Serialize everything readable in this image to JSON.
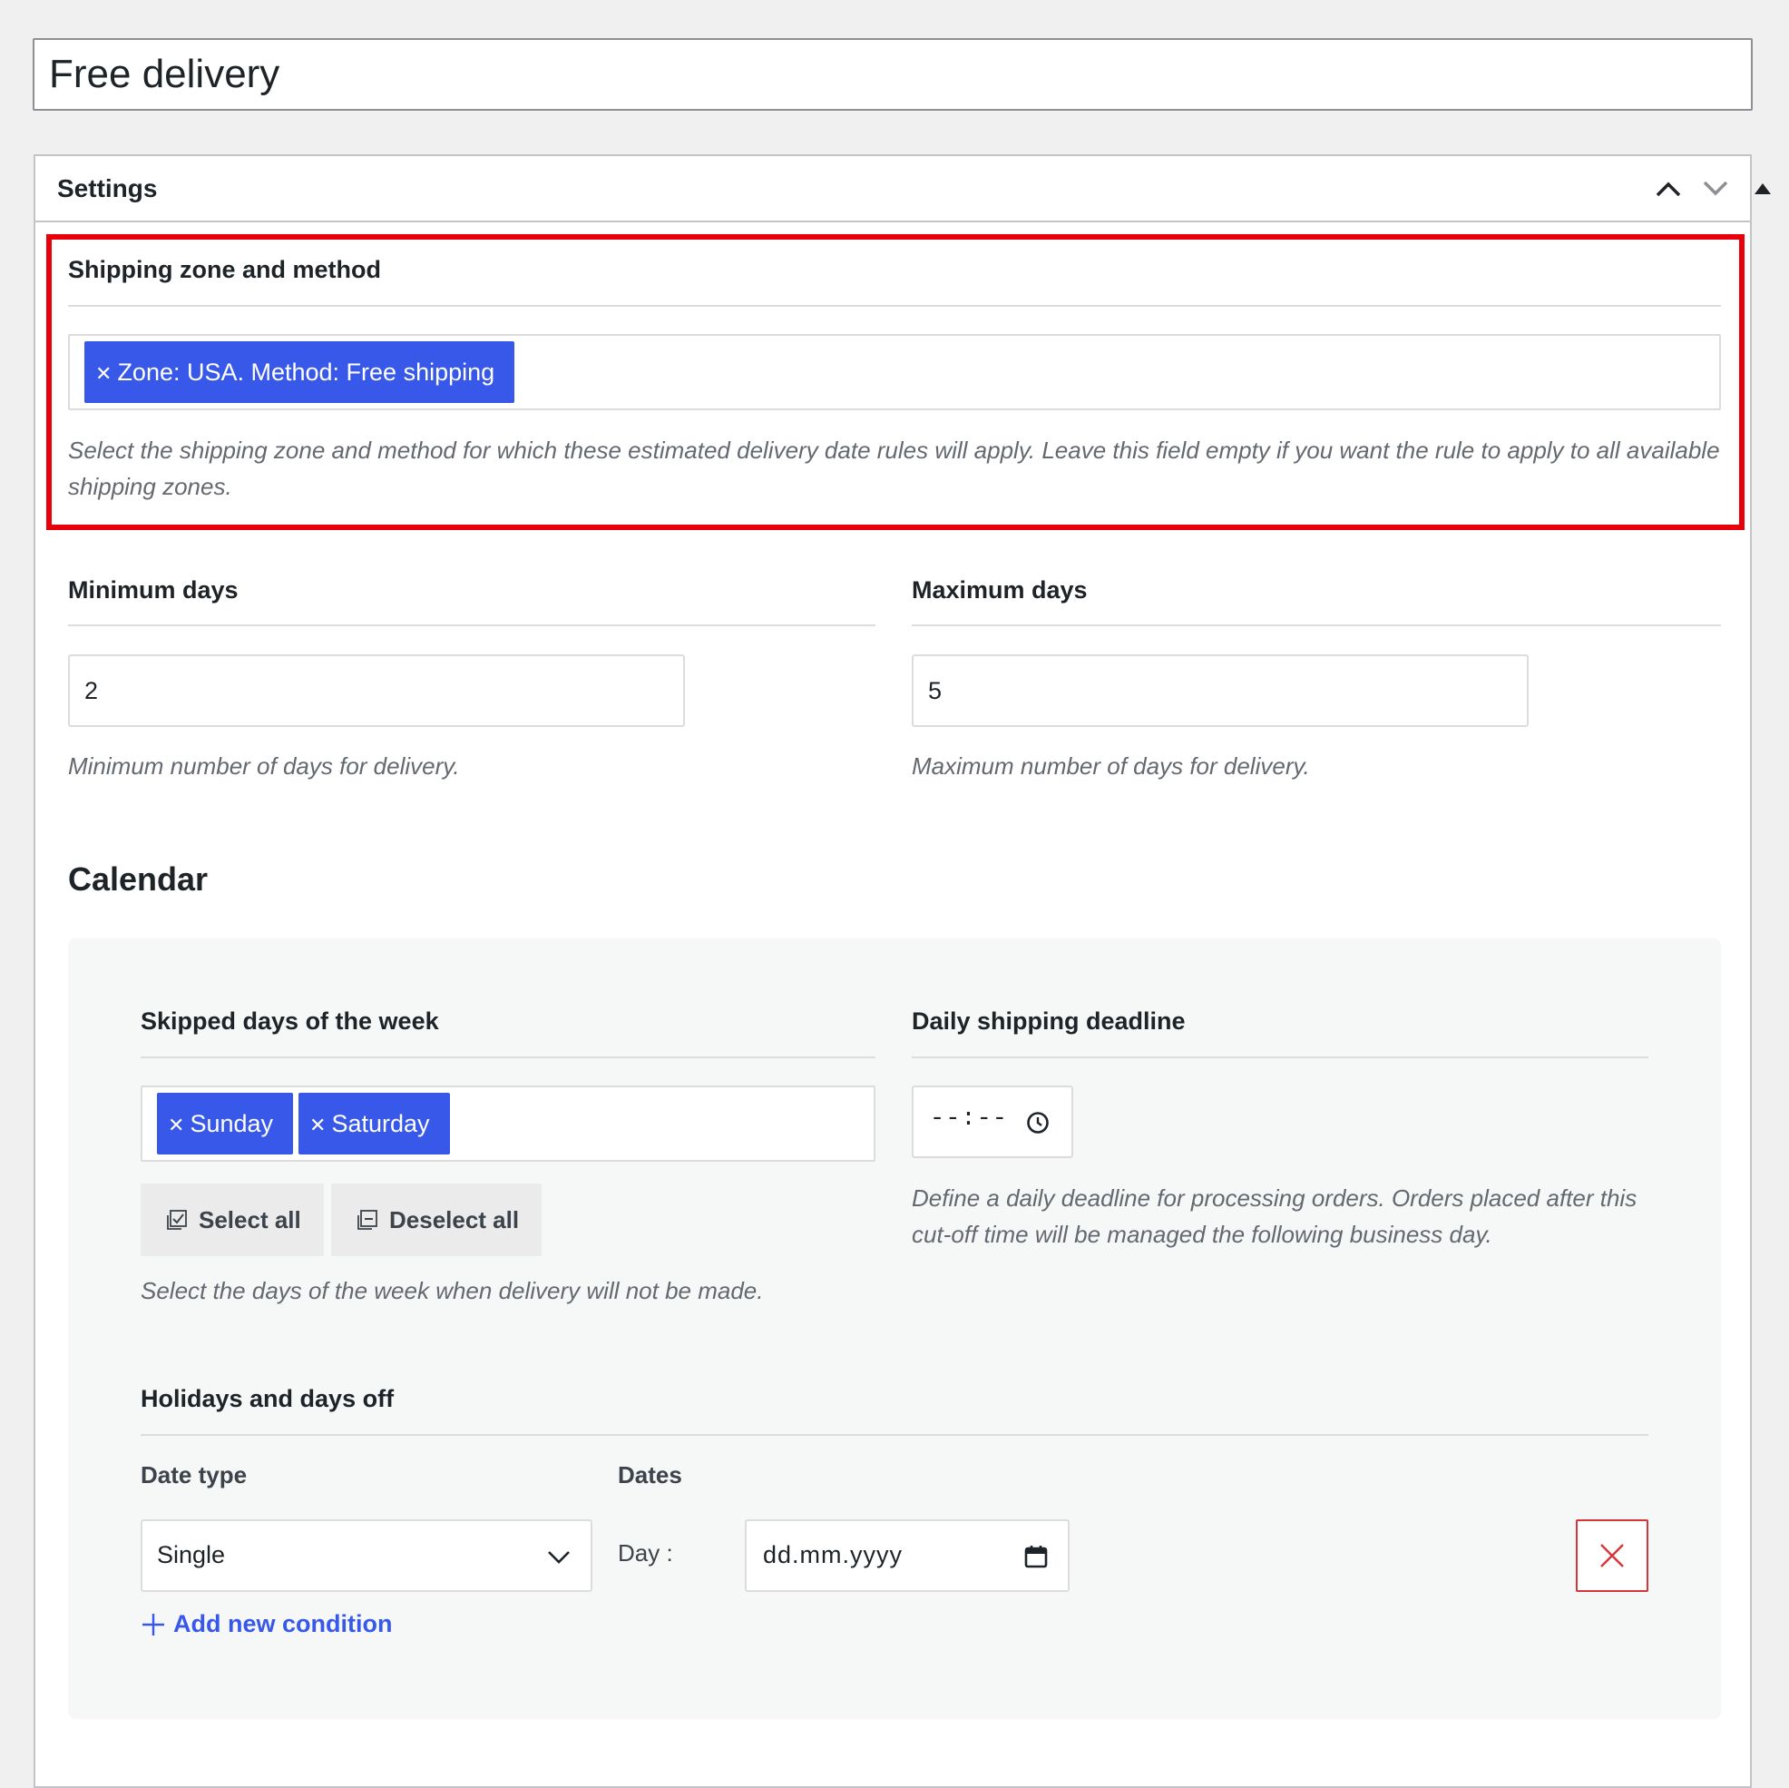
{
  "title": "Free delivery",
  "settings": {
    "title": "Settings",
    "header_icons": [
      "chevron-up-icon",
      "chevron-down-icon",
      "triangle-up-icon"
    ]
  },
  "shipping": {
    "label": "Shipping zone and method",
    "chip": "Zone: USA. Method: Free shipping",
    "help": "Select the shipping zone and method for which these estimated delivery date rules will apply. Leave this field empty if you want the rule to apply to all available shipping zones."
  },
  "min_days": {
    "label": "Minimum days",
    "value": "2",
    "help": "Minimum number of days for delivery."
  },
  "max_days": {
    "label": "Maximum days",
    "value": "5",
    "help": "Maximum number of days for delivery."
  },
  "calendar": {
    "heading": "Calendar",
    "skipped": {
      "label": "Skipped days of the week",
      "chips": [
        "Sunday",
        "Saturday"
      ],
      "select_all": "Select all",
      "deselect_all": "Deselect all",
      "help": "Select the days of the week when delivery will not be made."
    },
    "deadline": {
      "label": "Daily shipping deadline",
      "value": "--:--",
      "help": "Define a daily deadline for processing orders. Orders placed after this cut-off time will be managed the following business day."
    },
    "holidays": {
      "label": "Holidays and days off",
      "date_type_label": "Date type",
      "dates_label": "Dates",
      "date_type_value": "Single",
      "day_label": "Day :",
      "date_placeholder": "dd.mm.yyyy",
      "add_condition": "Add new condition"
    }
  },
  "colors": {
    "accent": "#3858e9",
    "highlight": "#e8000b",
    "delete": "#d63638"
  }
}
